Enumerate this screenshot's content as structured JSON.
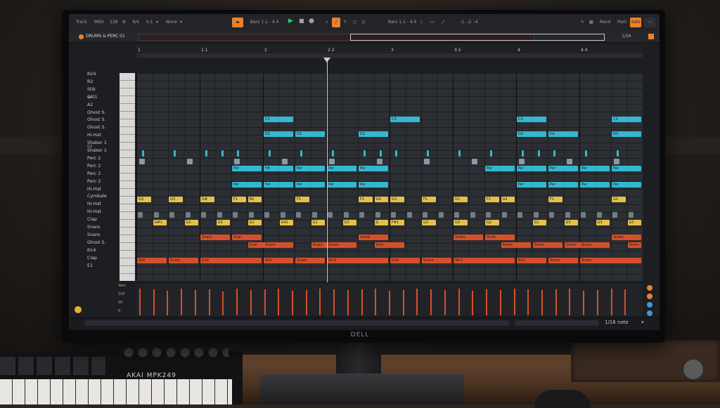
{
  "hardware": {
    "monitor_brand": "DELL",
    "keyboard_brand": "AKAI MPK249"
  },
  "transport": {
    "track_label": "Track",
    "midi_label": "MIDI",
    "tempo": "128",
    "meter": "4/4",
    "pos": "0.1",
    "scale": "None",
    "bars_left": "Bars 1.1 - 4.4",
    "bars_right": "Bars 1.1 - 4.4",
    "nudge": "-1.  -2.  -4",
    "rand_label": "Rand",
    "matrix_label": "Matr",
    "solo_label": "Solo",
    "y_label": "Y"
  },
  "clip": {
    "name": "DRUMS & PERC 01",
    "grid": "1/16"
  },
  "ruler": [
    {
      "label": "1",
      "beat": 0
    },
    {
      "label": "1.1",
      "beat": 2
    },
    {
      "label": "2",
      "beat": 4
    },
    {
      "label": "2.2",
      "beat": 6
    },
    {
      "label": "3",
      "beat": 8
    },
    {
      "label": "3.5",
      "beat": 10
    },
    {
      "label": "4",
      "beat": 12
    },
    {
      "label": "4.4",
      "beat": 14
    }
  ],
  "lanes": [
    "Kick",
    "R2",
    "Stik",
    "Gl01",
    "A2",
    "Ghost S.",
    "Ghost S.",
    "Ghost S.",
    "Hi-Hat",
    "Shaker 1",
    "Shaker 1",
    "Perc 2",
    "Perc 2",
    "Perc 2",
    "Perc 2",
    "Hi-Hat",
    "Cymbale",
    "Hi-Hat",
    "Hi-Hat",
    "Clap",
    "Snare",
    "Snare",
    "Ghost S.",
    "Kick",
    "Clap",
    "E1"
  ],
  "small_labels": {
    "ws": "ws",
    "g3": "G3",
    "c1": "C1",
    "g2": "G2"
  },
  "notes": {
    "cyan_c3": [
      {
        "start": 8,
        "len": 2,
        "label": "C3"
      },
      {
        "start": 16,
        "len": 2,
        "label": "C3"
      },
      {
        "start": 24,
        "len": 2,
        "label": "C3"
      },
      {
        "start": 30,
        "len": 2,
        "label": "C3"
      }
    ],
    "cyan_d2": [
      {
        "start": 8,
        "len": 2,
        "label": "D2"
      },
      {
        "start": 10,
        "len": 2,
        "label": "D2"
      },
      {
        "start": 14,
        "len": 2,
        "label": "D2"
      },
      {
        "start": 24,
        "len": 2,
        "label": "D2"
      },
      {
        "start": 26,
        "len": 2,
        "label": "D2"
      },
      {
        "start": 30,
        "len": 2,
        "label": "D3"
      }
    ],
    "cyan_perc_a": [
      {
        "start": 6,
        "len": 2,
        "label": "Per"
      },
      {
        "start": 8,
        "len": 2,
        "label": "F#"
      },
      {
        "start": 10,
        "len": 2,
        "label": "Per"
      },
      {
        "start": 12,
        "len": 2,
        "label": "Per"
      },
      {
        "start": 14,
        "len": 2,
        "label": "Per"
      },
      {
        "start": 22,
        "len": 2,
        "label": "Per"
      },
      {
        "start": 24,
        "len": 2,
        "label": "Per"
      },
      {
        "start": 26,
        "len": 2,
        "label": "Per"
      },
      {
        "start": 28,
        "len": 2,
        "label": "Per"
      },
      {
        "start": 30,
        "len": 2,
        "label": "Per"
      }
    ],
    "cyan_perc_b": [
      {
        "start": 6,
        "len": 2,
        "label": "Per"
      },
      {
        "start": 8,
        "len": 2,
        "label": "Per"
      },
      {
        "start": 10,
        "len": 2,
        "label": "Per"
      },
      {
        "start": 12,
        "len": 2,
        "label": "Per"
      },
      {
        "start": 14,
        "len": 2,
        "label": "Per"
      },
      {
        "start": 24,
        "len": 2,
        "label": "Per"
      },
      {
        "start": 26,
        "len": 2,
        "label": "Per"
      },
      {
        "start": 28,
        "len": 2,
        "label": "Per"
      },
      {
        "start": 30,
        "len": 2,
        "label": "Per"
      }
    ],
    "yel_row1": [
      {
        "start": 0,
        "len": 1,
        "label": "G3"
      },
      {
        "start": 2,
        "len": 1,
        "label": "G3"
      },
      {
        "start": 4,
        "len": 1,
        "label": "G#"
      },
      {
        "start": 6,
        "len": 1,
        "label": "F1"
      },
      {
        "start": 7,
        "len": 1,
        "label": "B4"
      },
      {
        "start": 10,
        "len": 1,
        "label": "F1"
      },
      {
        "start": 14,
        "len": 1,
        "label": "F1"
      },
      {
        "start": 15,
        "len": 1,
        "label": "G4"
      },
      {
        "start": 16,
        "len": 1,
        "label": "G3"
      },
      {
        "start": 18,
        "len": 1,
        "label": "F1"
      },
      {
        "start": 20,
        "len": 1,
        "label": "G1"
      },
      {
        "start": 22,
        "len": 1,
        "label": "F1"
      },
      {
        "start": 23,
        "len": 1,
        "label": "G4"
      },
      {
        "start": 26,
        "len": 1,
        "label": "F1"
      },
      {
        "start": 30,
        "len": 1,
        "label": "G2"
      }
    ],
    "yel_row2": [
      {
        "start": 1,
        "len": 1,
        "label": "G#1"
      },
      {
        "start": 3,
        "len": 1,
        "label": "G3"
      },
      {
        "start": 5,
        "len": 1,
        "label": "G3"
      },
      {
        "start": 7,
        "len": 1,
        "label": "G1"
      },
      {
        "start": 9,
        "len": 1,
        "label": "G41"
      },
      {
        "start": 11,
        "len": 1,
        "label": "G1"
      },
      {
        "start": 13,
        "len": 1,
        "label": "G3"
      },
      {
        "start": 15,
        "len": 1,
        "label": "G"
      },
      {
        "start": 16,
        "len": 1,
        "label": "F#1"
      },
      {
        "start": 18,
        "len": 1,
        "label": "G3"
      },
      {
        "start": 20,
        "len": 1,
        "label": "G3"
      },
      {
        "start": 22,
        "len": 1,
        "label": "G2"
      },
      {
        "start": 25,
        "len": 1,
        "label": "G1"
      },
      {
        "start": 27,
        "len": 1,
        "label": "G3"
      },
      {
        "start": 29,
        "len": 1,
        "label": "G3"
      },
      {
        "start": 31,
        "len": 1,
        "label": "G3"
      }
    ],
    "red_row1": [
      {
        "start": 4,
        "len": 2,
        "label": "Snare"
      },
      {
        "start": 6,
        "len": 2,
        "label": "Snar"
      },
      {
        "start": 14,
        "len": 2,
        "label": "Snare"
      },
      {
        "start": 20,
        "len": 2,
        "label": "Snare"
      },
      {
        "start": 22,
        "len": 2,
        "label": "Sn44"
      },
      {
        "start": 30,
        "len": 2,
        "label": "Snare"
      }
    ],
    "red_row2": [
      {
        "start": 7,
        "len": 2,
        "label": "Snar"
      },
      {
        "start": 8,
        "len": 2,
        "label": "Snare"
      },
      {
        "start": 11,
        "len": 2,
        "label": "Snare"
      },
      {
        "start": 12,
        "len": 2,
        "label": "Snare"
      },
      {
        "start": 15,
        "len": 2,
        "label": "Snar"
      },
      {
        "start": 23,
        "len": 2,
        "label": "Snare"
      },
      {
        "start": 25,
        "len": 2,
        "label": "Snare"
      },
      {
        "start": 27,
        "len": 2,
        "label": "Snare"
      },
      {
        "start": 28,
        "len": 2,
        "label": "Snare"
      },
      {
        "start": 31,
        "len": 1,
        "label": "Snare"
      }
    ],
    "red_kick": [
      {
        "start": 0,
        "len": 2,
        "label": "Stik"
      },
      {
        "start": 2,
        "len": 2,
        "label": "Snare"
      },
      {
        "start": 4,
        "len": 4,
        "label": "Kick"
      },
      {
        "start": 8,
        "len": 2,
        "label": "Stik"
      },
      {
        "start": 10,
        "len": 2,
        "label": "Snare"
      },
      {
        "start": 12,
        "len": 4,
        "label": "Stk3"
      },
      {
        "start": 16,
        "len": 2,
        "label": "Kick"
      },
      {
        "start": 18,
        "len": 2,
        "label": "Snare"
      },
      {
        "start": 20,
        "len": 4,
        "label": "Stk3"
      },
      {
        "start": 24,
        "len": 2,
        "label": "Kick"
      },
      {
        "start": 26,
        "len": 2,
        "label": "Snare"
      },
      {
        "start": 28,
        "len": 4,
        "label": "Snare"
      }
    ]
  },
  "velocity": {
    "labels": [
      "Velo",
      "100",
      "50",
      "0"
    ],
    "values": [
      0.95,
      0.92,
      0.88,
      0.95,
      0.9,
      0.93,
      0.85,
      0.95,
      0.9,
      0.92,
      0.94,
      0.88,
      0.9,
      0.95,
      0.93,
      0.9,
      0.92,
      0.95,
      0.88,
      0.9,
      0.94,
      0.92,
      0.9,
      0.95,
      0.88,
      0.92,
      0.9,
      0.95,
      0.93,
      0.9,
      0.92,
      0.95,
      0.88,
      0.9,
      0.94,
      0.92
    ]
  },
  "footer": {
    "grid_select": "1/16 note"
  },
  "colors": {
    "cyan": "#35b8cf",
    "yellow": "#e4c24a",
    "red": "#d5502a",
    "accent": "#e8822e"
  }
}
